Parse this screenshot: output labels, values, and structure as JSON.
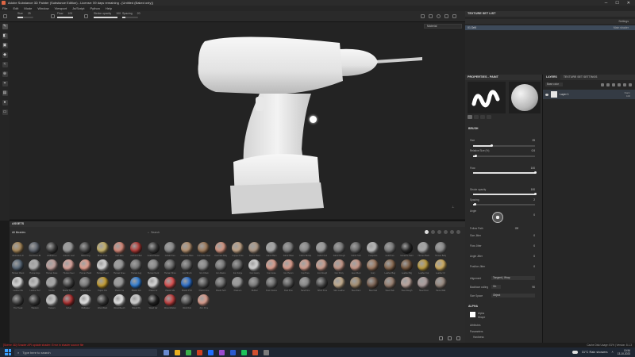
{
  "titlebar": {
    "title": "Adobe Substance 3D Painter (Substance Edition) - License: 59 days remaining - [Untitled (Baked only)]",
    "win_controls": [
      "─",
      "☐",
      "✕"
    ]
  },
  "menubar": {
    "items": [
      "File",
      "Edit",
      "Mode",
      "Window",
      "Viewport",
      "Js/Script",
      "Python",
      "Help"
    ]
  },
  "toolbar": {
    "size_label": "Size",
    "size_value": "25",
    "size_fill": 0.35,
    "flow_label": "Flow",
    "flow_value": "100",
    "flow_fill": 1.0,
    "stroke_label": "Stroke opacity",
    "stroke_value": "100",
    "stroke_fill": 1.0,
    "spacing_label": "Spacing",
    "spacing_value": "20",
    "spacing_fill": 0.2,
    "right_icons": [
      "camera-icon",
      "view-icon",
      "render-icon",
      "screen-icon",
      "camera2-icon"
    ]
  },
  "left_tools": [
    "brush-icon",
    "eraser-icon",
    "projection-icon",
    "polygon-fill-icon",
    "smudge-icon",
    "clone-icon",
    "picker-icon",
    "geometry-icon",
    "material-icon",
    "dimension-icon"
  ],
  "viewport": {
    "mode": "Material",
    "axis": "⊥"
  },
  "texture_set_list": {
    "title": "TEXTURE SET LIST",
    "header_right": "Settings",
    "item_name": "01 Drill",
    "item_right": "Main shader"
  },
  "properties": {
    "title": "PROPERTIES - PAINT",
    "brush_title": "BRUSH",
    "size_label": "Size",
    "size_value": "25",
    "size_fill": 0.3,
    "size_cm_label": "Relative Size (%)",
    "size_cm_value": "0.5",
    "size_cm_fill": 0.05,
    "flow_label": "Flow",
    "flow_value": "100",
    "flow_fill": 1.0,
    "stroke_label": "Stroke opacity",
    "stroke_value": "100",
    "stroke_fill": 1.0,
    "spacing_label": "Spacing",
    "spacing_value": "2",
    "spacing_fill": 0.03,
    "angle_label": "Angle",
    "angle_value": "0",
    "follow_label": "Follow Path",
    "follow_value": "Off",
    "size_jitter_label": "Size Jitter",
    "size_jitter_value": "0",
    "flow_jitter_label": "Flow Jitter",
    "flow_jitter_value": "0",
    "angle_jitter_label": "Angle Jitter",
    "angle_jitter_value": "0",
    "pos_jitter_label": "Position Jitter",
    "pos_jitter_value": "0",
    "alignment_label": "Alignment",
    "alignment_value": "Tangent | Wrap",
    "backface_label": "Backface culling",
    "backface_value": "On",
    "backface_num": "90",
    "size_space_label": "Size Space",
    "size_space_value": "Object",
    "alpha_title": "ALPHA",
    "alpha_name": "Alpha",
    "alpha_sub": "Shape",
    "attributes_label": "Attributes",
    "parameters_label": "Parameters",
    "hardness_label": "Hardness"
  },
  "layers": {
    "tabs": [
      "LAYERS",
      "TEXTURE SET SETTINGS"
    ],
    "blend_mode": "Base color",
    "layer_name": "Layer 1",
    "layer_right_top": "Norm",
    "layer_right_bottom": "100"
  },
  "assets": {
    "title": "ASSETS",
    "filter": "All libraries",
    "search_placeholder": "Search",
    "materials": [
      {
        "name": "Aluminium Ar",
        "color": "#a9895a"
      },
      {
        "name": "Aluminium Bl",
        "color": "#5c626c"
      },
      {
        "name": "Artificial Le",
        "color": "#3d3d3d"
      },
      {
        "name": "Autumn Leaf",
        "color": "#9a9a9a"
      },
      {
        "name": "Baked Lig",
        "color": "#4a4a4a"
      },
      {
        "name": "Brass Pure",
        "color": "#c9b46a"
      },
      {
        "name": "Calf Skin",
        "color": "#d98a7a"
      },
      {
        "name": "Carbon Fiber",
        "color": "#b53a36"
      },
      {
        "name": "Coated Metal",
        "color": "#3c3c3c"
      },
      {
        "name": "Cobalt Pure",
        "color": "#8a8a8a"
      },
      {
        "name": "Concrete Bare",
        "color": "#b69270"
      },
      {
        "name": "Concrete Clean",
        "color": "#a07b5a"
      },
      {
        "name": "Concrete Dirty",
        "color": "#d69682"
      },
      {
        "name": "Copper Pure",
        "color": "#c4a688"
      },
      {
        "name": "Denim Rivet",
        "color": "#b09a86"
      },
      {
        "name": "Fabric Barn",
        "color": "#a8a8a8"
      },
      {
        "name": "Fabric Base",
        "color": "#7d7d7d"
      },
      {
        "name": "Fabric Burlap",
        "color": "#8a8a8a"
      },
      {
        "name": "Fabric Knit",
        "color": "#9a9a9a"
      },
      {
        "name": "Fabric Rough",
        "color": "#7a7a7a"
      },
      {
        "name": "Fabric Soft",
        "color": "#6a6a6a"
      },
      {
        "name": "Footprints",
        "color": "#bdbdbd"
      },
      {
        "name": "Gold Pure",
        "color": "#7a7a7a"
      },
      {
        "name": "Gouache Paint",
        "color": "#2a2a2a"
      },
      {
        "name": "Human Back",
        "color": "#a8a8a8"
      },
      {
        "name": "Human Belly",
        "color": "#8a8a8a"
      },
      {
        "name": "Human Chest",
        "color": "#5a6a7a"
      },
      {
        "name": "Human Eye",
        "color": "#b5b5b5"
      },
      {
        "name": "Human Face",
        "color": "#c4a4a0"
      },
      {
        "name": "Human Feet",
        "color": "#e0a8a0"
      },
      {
        "name": "Human Hand",
        "color": "#e8a090"
      },
      {
        "name": "Human Head",
        "color": "#ddd"
      },
      {
        "name": "Human Knee",
        "color": "#999"
      },
      {
        "name": "Human Leg",
        "color": "#777"
      },
      {
        "name": "Human Neck",
        "color": "#8a8a8a"
      },
      {
        "name": "Human Shou",
        "color": "#666"
      },
      {
        "name": "Iron Brush",
        "color": "#6a6a6a"
      },
      {
        "name": "Iron Chain",
        "color": "#888"
      },
      {
        "name": "Iron Diamo",
        "color": "#777"
      },
      {
        "name": "Iron Forge",
        "color": "#666"
      },
      {
        "name": "Iron Grainy",
        "color": "#dcdcdc"
      },
      {
        "name": "Iron Grate",
        "color": "#e0a090"
      },
      {
        "name": "Iron Hamm",
        "color": "#e0a090"
      },
      {
        "name": "Iron Pure",
        "color": "#d8a090"
      },
      {
        "name": "Iron Rough",
        "color": "#d0a090"
      },
      {
        "name": "Iron Shiny",
        "color": "#c89a8a"
      },
      {
        "name": "Jean Rivet",
        "color": "#cc9a8a"
      },
      {
        "name": "Ivory",
        "color": "#a07a60"
      },
      {
        "name": "Leather Bag",
        "color": "#8a6a50"
      },
      {
        "name": "Leather Big",
        "color": "#7a5a40"
      },
      {
        "name": "Leather Cal",
        "color": "#c0a040"
      },
      {
        "name": "Leather Cr",
        "color": "#d4b060"
      },
      {
        "name": "Leather Me",
        "color": "#e0e0e0"
      },
      {
        "name": "Leather Sof",
        "color": "#c8c8c8"
      },
      {
        "name": "Marble",
        "color": "#aaa"
      },
      {
        "name": "Mortar Fabric",
        "color": "#444"
      },
      {
        "name": "Nickel Pure",
        "color": "#7a7a7a"
      },
      {
        "name": "Paper Cra",
        "color": "#c8a030"
      },
      {
        "name": "Plastic Ca",
        "color": "#9a9a9a"
      },
      {
        "name": "Plastic Glo",
        "color": "#2f7fd8"
      },
      {
        "name": "Plastic Gr",
        "color": "#e0e0e0"
      },
      {
        "name": "Plastic Ma",
        "color": "#e05050"
      },
      {
        "name": "Plastic PVC",
        "color": "#2a6fcf"
      },
      {
        "name": "Plastic Rou",
        "color": "#555"
      },
      {
        "name": "Plastic Soft",
        "color": "#6a6a6a"
      },
      {
        "name": "Platinum",
        "color": "#9a9a9a"
      },
      {
        "name": "Rubber",
        "color": "#7a7a7a"
      },
      {
        "name": "Rust Coarse",
        "color": "#6a6a6a"
      },
      {
        "name": "Rust Fine",
        "color": "#5a5a5a"
      },
      {
        "name": "Sand Fine",
        "color": "#8a8a8a"
      },
      {
        "name": "Silver Pure",
        "color": "#4a4a4a"
      },
      {
        "name": "Skin Leather",
        "color": "#c8b090"
      },
      {
        "name": "Steel Dam",
        "color": "#a89070"
      },
      {
        "name": "Steel Gal",
        "color": "#7a6050"
      },
      {
        "name": "Steel Pain",
        "color": "#9a8070"
      },
      {
        "name": "Steel Rough",
        "color": "#c0a8a0"
      },
      {
        "name": "Steel Rust",
        "color": "#b0a0a0"
      },
      {
        "name": "Stone Wall",
        "color": "#9a8a80"
      },
      {
        "name": "Tire Tread",
        "color": "#444"
      },
      {
        "name": "Titanium",
        "color": "#3a3a3a"
      },
      {
        "name": "Trainers",
        "color": "#d0d0d0"
      },
      {
        "name": "Velvet",
        "color": "#b03030"
      },
      {
        "name": "Wallpaper",
        "color": "#eee"
      },
      {
        "name": "Wood Bark",
        "color": "#3a3a3a"
      },
      {
        "name": "Wood Beech",
        "color": "#eee"
      },
      {
        "name": "Wood Ply",
        "color": "#d8d8d8"
      },
      {
        "name": "Wood Var",
        "color": "#222"
      },
      {
        "name": "Wood Walnut",
        "color": "#c44040"
      },
      {
        "name": "Wool Knit",
        "color": "#555"
      },
      {
        "name": "Zinc Pure",
        "color": "#e0a090"
      }
    ]
  },
  "status": {
    "error": "[Scene 3D] Shader API update shader: Error in shader source file",
    "right": "Cache Disk Usage: 81% | Version: 8.1.3"
  },
  "taskbar": {
    "search_placeholder": "Type here to search",
    "apps": [
      "#6a8ad0",
      "#e8b020",
      "#3ab04a",
      "#d04020",
      "#1f6fff",
      "#9a4ad0",
      "#2a5ad0",
      "#1dc25a",
      "#d05030",
      "#7a7a7a"
    ],
    "weather": "31°C  Rain showers",
    "time": "10:54",
    "date": "13-10-2023"
  }
}
